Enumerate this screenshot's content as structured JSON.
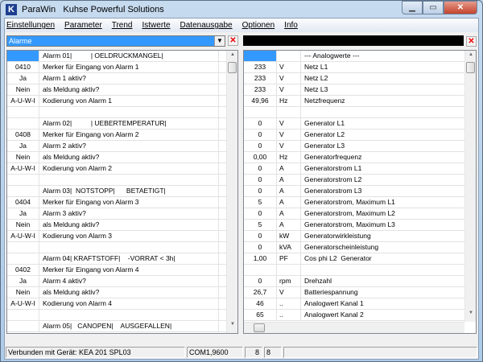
{
  "window": {
    "app": "ParaWin",
    "title": "Kuhse Powerful Solutions",
    "logo": "K"
  },
  "menu": [
    "Einstellungen",
    "Parameter",
    "Trend",
    "Istwerte",
    "Datenausgabe",
    "Optionen",
    "Info"
  ],
  "left": {
    "selector": "Alarme",
    "rows": [
      [
        "",
        "Alarm 01|          | OELDRUCKMANGEL|"
      ],
      [
        "0410",
        "Merker für Eingang von Alarm 1"
      ],
      [
        "Ja",
        "Alarm 1 aktiv?"
      ],
      [
        "Nein",
        "als Meldung aktiv?"
      ],
      [
        "A-U-W-I",
        "Kodierung von Alarm 1"
      ],
      [
        "",
        ""
      ],
      [
        "",
        "Alarm 02|          | UEBERTEMPERATUR|"
      ],
      [
        "0408",
        "Merker für Eingang von Alarm 2"
      ],
      [
        "Ja",
        "Alarm 2 aktiv?"
      ],
      [
        "Nein",
        "als Meldung aktiv?"
      ],
      [
        "A-U-W-I",
        "Kodierung von Alarm 2"
      ],
      [
        "",
        ""
      ],
      [
        "",
        "Alarm 03|  NOTSTOPP|      BETAETIGT|"
      ],
      [
        "0404",
        "Merker für Eingang von Alarm 3"
      ],
      [
        "Ja",
        "Alarm 3 aktiv?"
      ],
      [
        "Nein",
        "als Meldung aktiv?"
      ],
      [
        "A-U-W-I",
        "Kodierung von Alarm 3"
      ],
      [
        "",
        ""
      ],
      [
        "",
        "Alarm 04| KRAFTSTOFF|    -VORRAT < 3h|"
      ],
      [
        "0402",
        "Merker für Eingang von Alarm 4"
      ],
      [
        "Ja",
        "Alarm 4 aktiv?"
      ],
      [
        "Nein",
        "als Meldung aktiv?"
      ],
      [
        "A-U-W-I",
        "Kodierung von Alarm 4"
      ],
      [
        "",
        ""
      ],
      [
        "",
        "Alarm 05|   CANOPEN|    AUSGEFALLEN|"
      ]
    ]
  },
  "right": {
    "rows": [
      [
        "",
        "",
        "--- Analogwerte ---"
      ],
      [
        "233",
        "V",
        "Netz L1"
      ],
      [
        "233",
        "V",
        "Netz L2"
      ],
      [
        "233",
        "V",
        "Netz L3"
      ],
      [
        "49,96",
        "Hz",
        "Netzfrequenz"
      ],
      [
        "",
        "",
        ""
      ],
      [
        "0",
        "V",
        "Generator L1"
      ],
      [
        "0",
        "V",
        "Generator L2"
      ],
      [
        "0",
        "V",
        "Generator L3"
      ],
      [
        "0,00",
        "Hz",
        "Generatorfrequenz"
      ],
      [
        "0",
        "A",
        "Generatorstrom L1"
      ],
      [
        "0",
        "A",
        "Generatorstrom L2"
      ],
      [
        "0",
        "A",
        "Generatorstrom L3"
      ],
      [
        "5",
        "A",
        "Generatorstrom, Maximum L1"
      ],
      [
        "0",
        "A",
        "Generatorstrom, Maximum L2"
      ],
      [
        "5",
        "A",
        "Generatorstrom, Maximum L3"
      ],
      [
        "0",
        "kW",
        "Generatorwirkleistung"
      ],
      [
        "0",
        "kVA",
        "Generatorscheinleistung"
      ],
      [
        "1,00",
        "PF",
        "Cos phi L2  Generator"
      ],
      [
        "",
        "",
        ""
      ],
      [
        "0",
        "rpm",
        "Drehzahl"
      ],
      [
        "26,7",
        "V",
        "Batteriespannung"
      ],
      [
        "46",
        "..",
        "Analogwert Kanal 1"
      ],
      [
        "65",
        "..",
        "Analogwert Kanal 2"
      ]
    ]
  },
  "status": {
    "connection": "Verbunden mit Gerät: KEA 201 SPL03",
    "port": "COM1,9600",
    "a": "8",
    "b": "8"
  }
}
